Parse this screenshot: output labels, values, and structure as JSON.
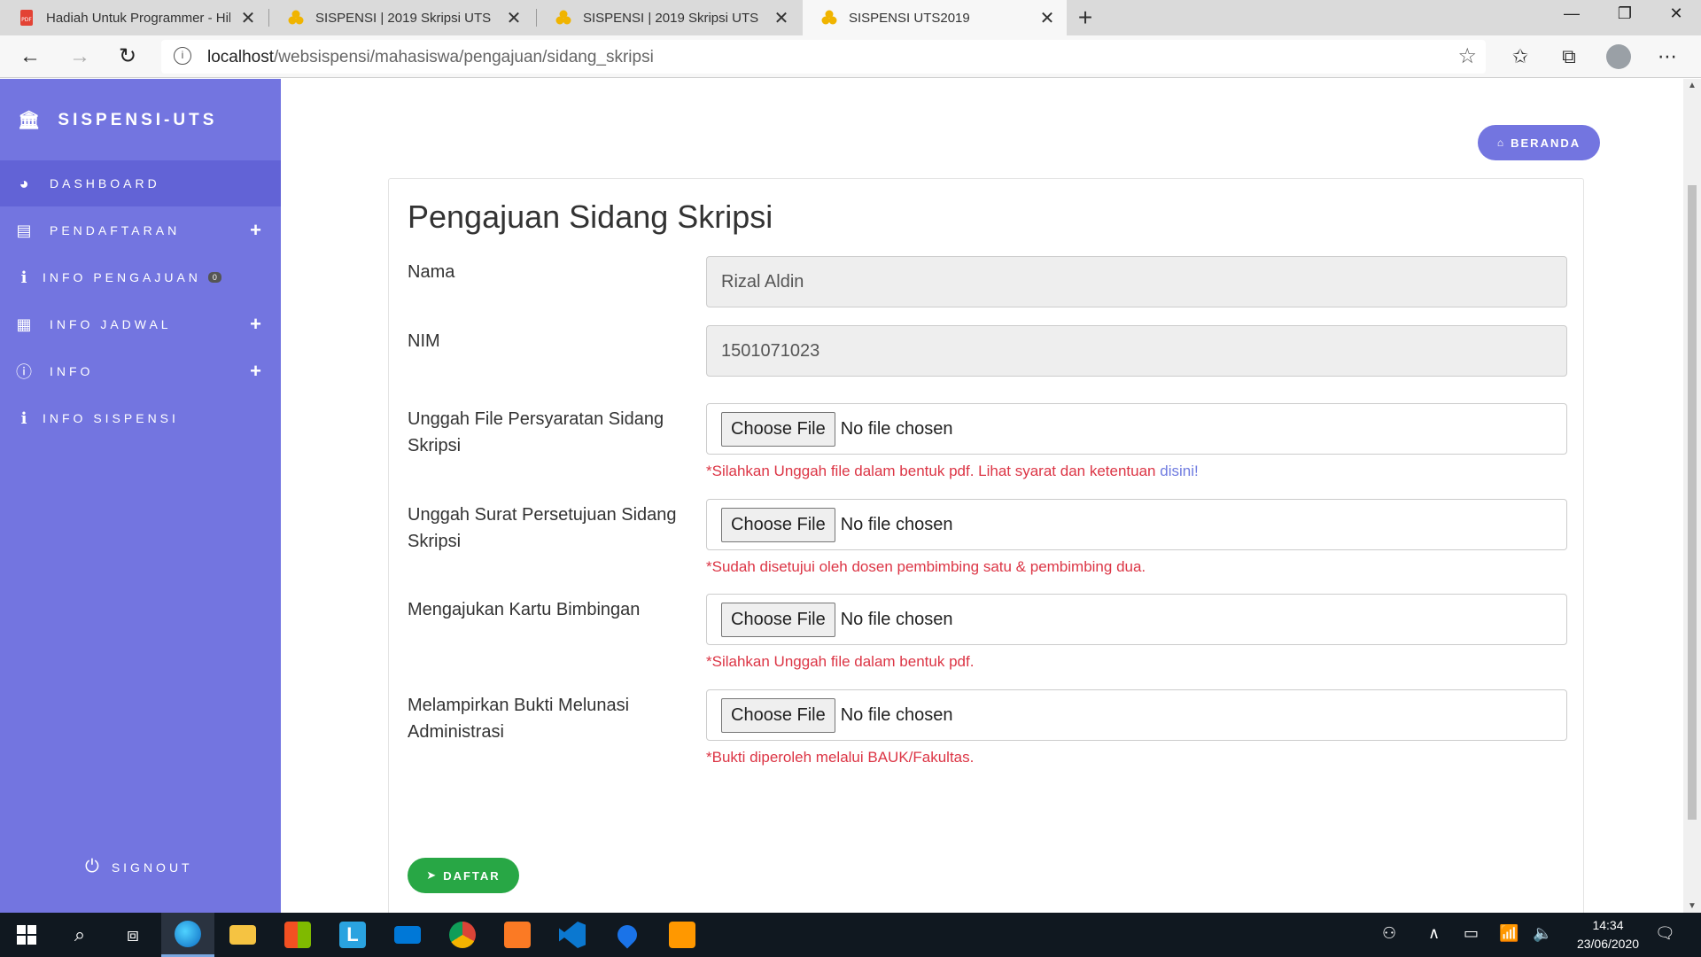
{
  "browser": {
    "tabs": [
      {
        "title": "Hadiah Untuk Programmer - Hil",
        "icon": "pdf-icon",
        "active": false
      },
      {
        "title": "SISPENSI | 2019 Skripsi UTS",
        "icon": "sispensi-icon",
        "active": false
      },
      {
        "title": "SISPENSI | 2019 Skripsi UTS",
        "icon": "sispensi-icon",
        "active": false
      },
      {
        "title": "SISPENSI UTS2019",
        "icon": "sispensi-icon",
        "active": true
      }
    ],
    "url_host": "localhost",
    "url_path": "/websispensi/mahasiswa/pengajuan/sidang_skripsi"
  },
  "sidebar": {
    "brand": "SISPENSI-UTS",
    "items": [
      {
        "label": "DASHBOARD",
        "icon": "dashboard-icon",
        "expandable": false
      },
      {
        "label": "PENDAFTARAN",
        "icon": "document-icon",
        "expandable": true
      },
      {
        "label": "INFO PENGAJUAN",
        "icon": "info-i-icon",
        "expandable": false,
        "badge": "0"
      },
      {
        "label": "INFO JADWAL",
        "icon": "calendar-icon",
        "expandable": true
      },
      {
        "label": "INFO",
        "icon": "info-circle-icon",
        "expandable": true
      },
      {
        "label": "INFO SISPENSI",
        "icon": "info-i-icon",
        "expandable": false
      }
    ],
    "signout": "SIGNOUT"
  },
  "main": {
    "beranda_button": "BERANDA",
    "title": "Pengajuan Sidang Skripsi",
    "fields": [
      {
        "label": "Nama",
        "value": "Rizal Aldin",
        "type": "text"
      },
      {
        "label": "NIM",
        "value": "1501071023",
        "type": "text"
      },
      {
        "label": "Unggah File Persyaratan Sidang Skripsi",
        "type": "file",
        "button": "Choose File",
        "status": "No file chosen",
        "help": "*Silahkan Unggah file dalam bentuk pdf. Lihat syarat dan ketentuan ",
        "help_link": "disini!"
      },
      {
        "label": "Unggah Surat Persetujuan Sidang Skripsi",
        "type": "file",
        "button": "Choose File",
        "status": "No file chosen",
        "help": "*Sudah disetujui oleh dosen pembimbing satu & pembimbing dua."
      },
      {
        "label": "Mengajukan Kartu Bimbingan",
        "type": "file",
        "button": "Choose File",
        "status": "No file chosen",
        "help": "*Silahkan Unggah file dalam bentuk pdf."
      },
      {
        "label": "Melampirkan Bukti Melunasi Administrasi",
        "type": "file",
        "button": "Choose File",
        "status": "No file chosen",
        "help": "*Bukti diperoleh melalui BAUK/Fakultas."
      }
    ],
    "submit_button": "DAFTAR"
  },
  "taskbar": {
    "time": "14:34",
    "date": "23/06/2020"
  }
}
